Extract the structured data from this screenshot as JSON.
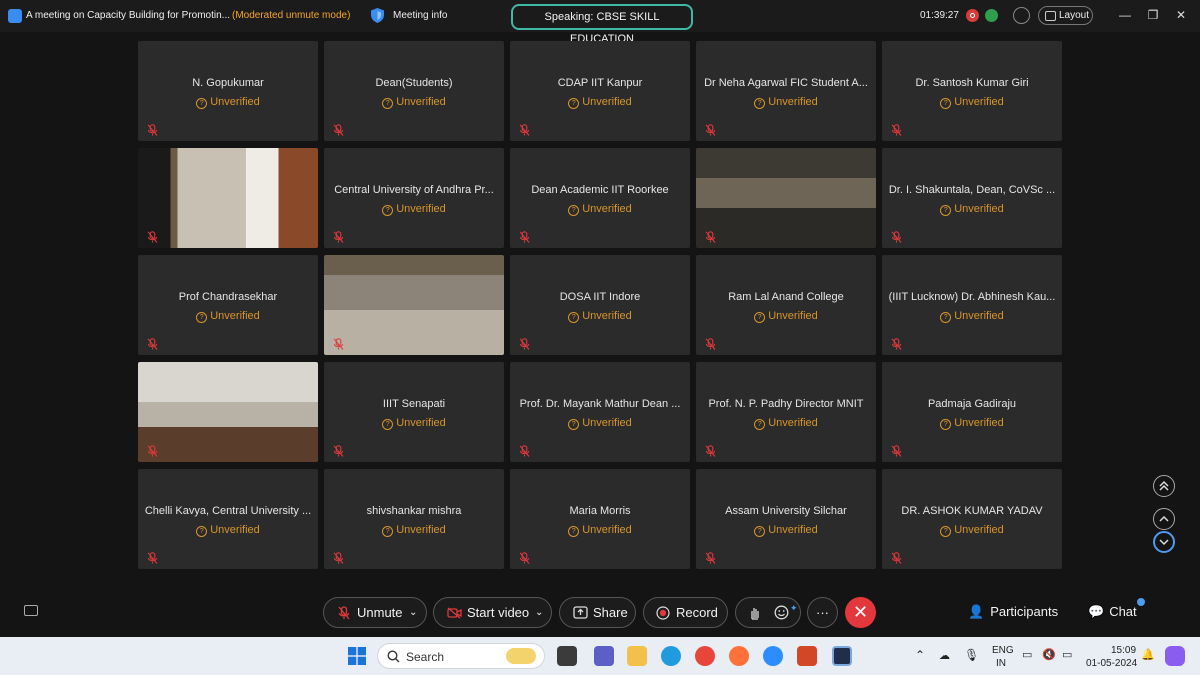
{
  "titlebar": {
    "title": "A meeting on Capacity Building for Promotin...",
    "mode": "(Moderated unmute mode)",
    "meeting_info": "Meeting info",
    "speaking": "Speaking: CBSE SKILL EDUCATION",
    "timer": "01:39:27",
    "layout": "Layout"
  },
  "participants": [
    {
      "name": "N. Gopukumar",
      "status": "Unverified",
      "video": false
    },
    {
      "name": "Dean(Students)",
      "status": "Unverified",
      "video": false
    },
    {
      "name": "CDAP IIT Kanpur",
      "status": "Unverified",
      "video": false
    },
    {
      "name": "Dr Neha Agarwal FIC Student A...",
      "status": "Unverified",
      "video": false
    },
    {
      "name": "Dr. Santosh Kumar Giri",
      "status": "Unverified",
      "video": false
    },
    {
      "name": "",
      "status": "",
      "video": true
    },
    {
      "name": "Central University of Andhra Pr...",
      "status": "Unverified",
      "video": false
    },
    {
      "name": "Dean Academic IIT Roorkee",
      "status": "Unverified",
      "video": false
    },
    {
      "name": "",
      "status": "",
      "video": true
    },
    {
      "name": "Dr. I. Shakuntala, Dean, CoVSc ...",
      "status": "Unverified",
      "video": false
    },
    {
      "name": "Prof Chandrasekhar",
      "status": "Unverified",
      "video": false
    },
    {
      "name": "",
      "status": "",
      "video": true
    },
    {
      "name": "DOSA IIT Indore",
      "status": "Unverified",
      "video": false
    },
    {
      "name": "Ram Lal Anand College",
      "status": "Unverified",
      "video": false
    },
    {
      "name": "(IIIT Lucknow) Dr. Abhinesh Kau...",
      "status": "Unverified",
      "video": false
    },
    {
      "name": "",
      "status": "",
      "video": true
    },
    {
      "name": "IIIT Senapati",
      "status": "Unverified",
      "video": false
    },
    {
      "name": "Prof. Dr. Mayank Mathur Dean ...",
      "status": "Unverified",
      "video": false
    },
    {
      "name": "Prof. N. P. Padhy Director MNIT",
      "status": "Unverified",
      "video": false
    },
    {
      "name": "Padmaja Gadiraju",
      "status": "Unverified",
      "video": false
    },
    {
      "name": "Chelli Kavya, Central University ...",
      "status": "Unverified",
      "video": false
    },
    {
      "name": "shivshankar mishra",
      "status": "Unverified",
      "video": false
    },
    {
      "name": "Maria Morris",
      "status": "Unverified",
      "video": false
    },
    {
      "name": "Assam University Silchar",
      "status": "Unverified",
      "video": false
    },
    {
      "name": "DR. ASHOK KUMAR YADAV",
      "status": "Unverified",
      "video": false
    }
  ],
  "toolbar": {
    "unmute": "Unmute",
    "start_video": "Start video",
    "share": "Share",
    "record": "Record",
    "participants": "Participants",
    "chat": "Chat"
  },
  "taskbar": {
    "search": "Search",
    "lang1": "ENG",
    "lang2": "IN",
    "time": "15:09",
    "date": "01-05-2024"
  },
  "colors": {
    "accent": "#3fb8a7",
    "unverified": "#d8952b",
    "end_call": "#e2383d",
    "tile_bg": "#2b2b2b"
  }
}
